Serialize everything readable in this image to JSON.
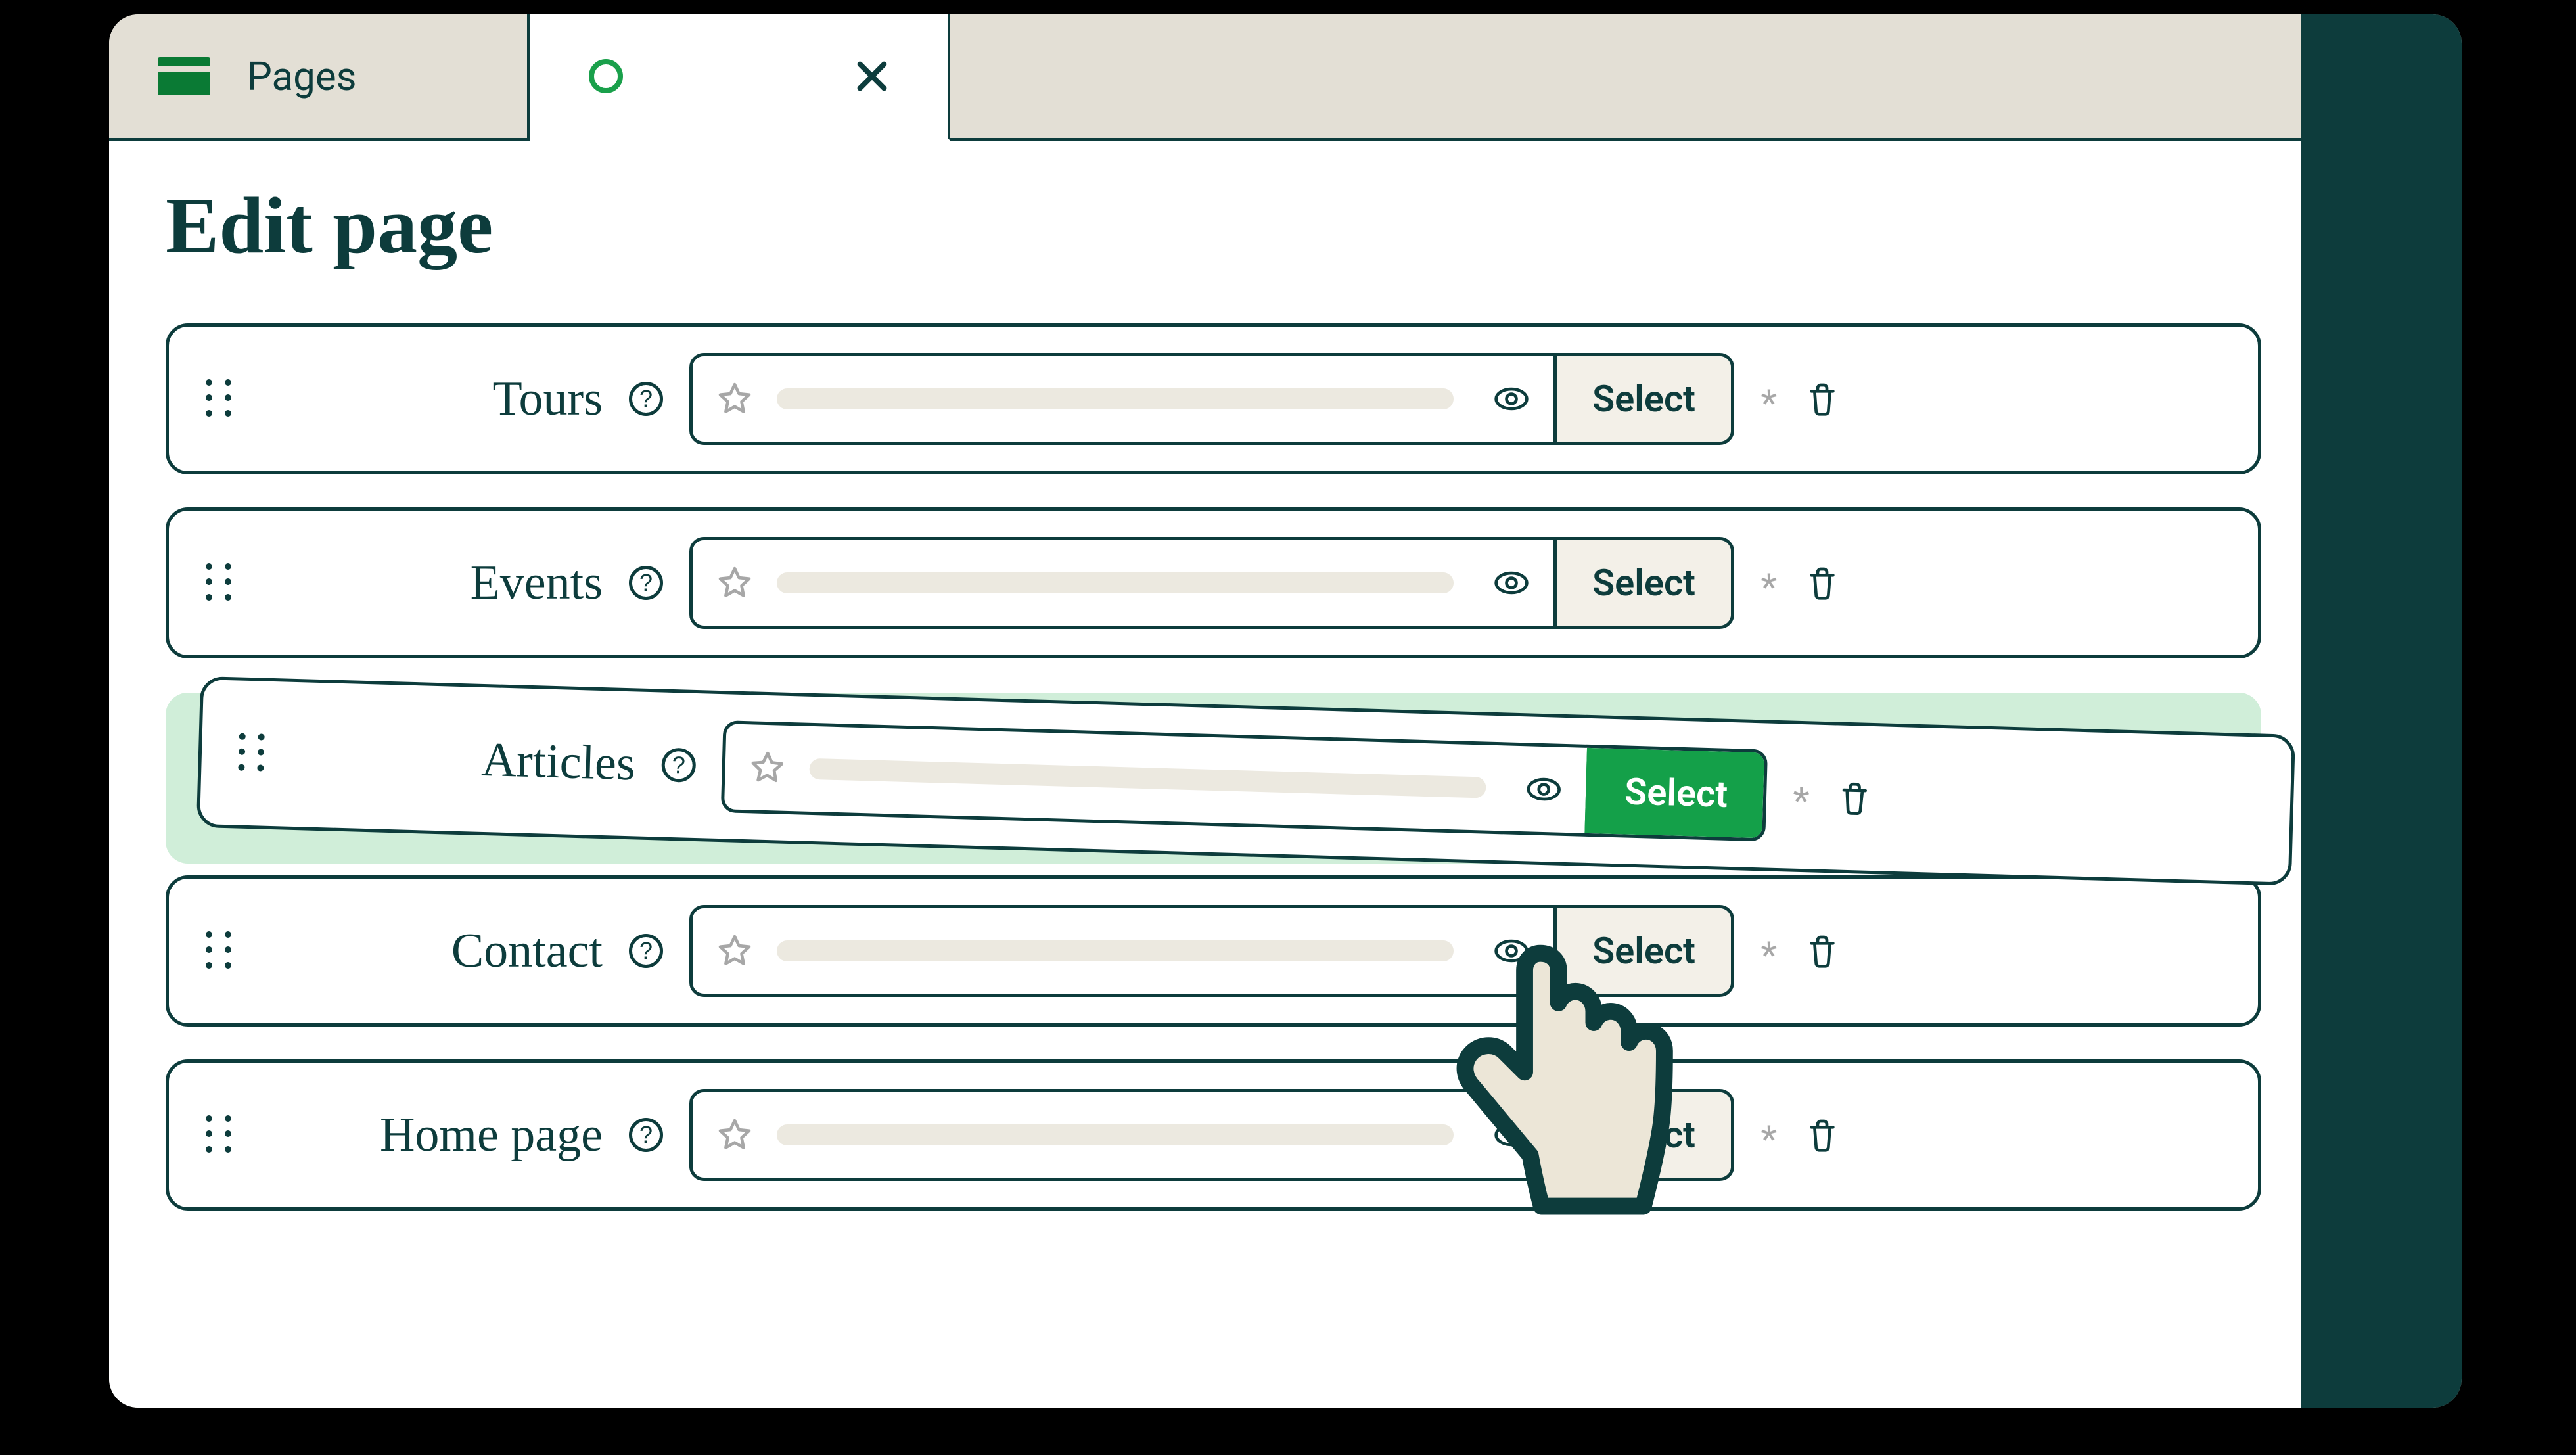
{
  "tabs": {
    "pages_label": "Pages"
  },
  "heading": "Edit page",
  "select_label": "Select",
  "rows": [
    {
      "label": "Tours",
      "starred": false,
      "selected": false,
      "dragging": false
    },
    {
      "label": "Events",
      "starred": false,
      "selected": false,
      "dragging": false
    },
    {
      "label": "Articles",
      "starred": true,
      "selected": true,
      "dragging": true
    },
    {
      "label": "Contact",
      "starred": false,
      "selected": false,
      "dragging": false
    },
    {
      "label": "Home page",
      "starred": false,
      "selected": false,
      "dragging": false
    }
  ]
}
